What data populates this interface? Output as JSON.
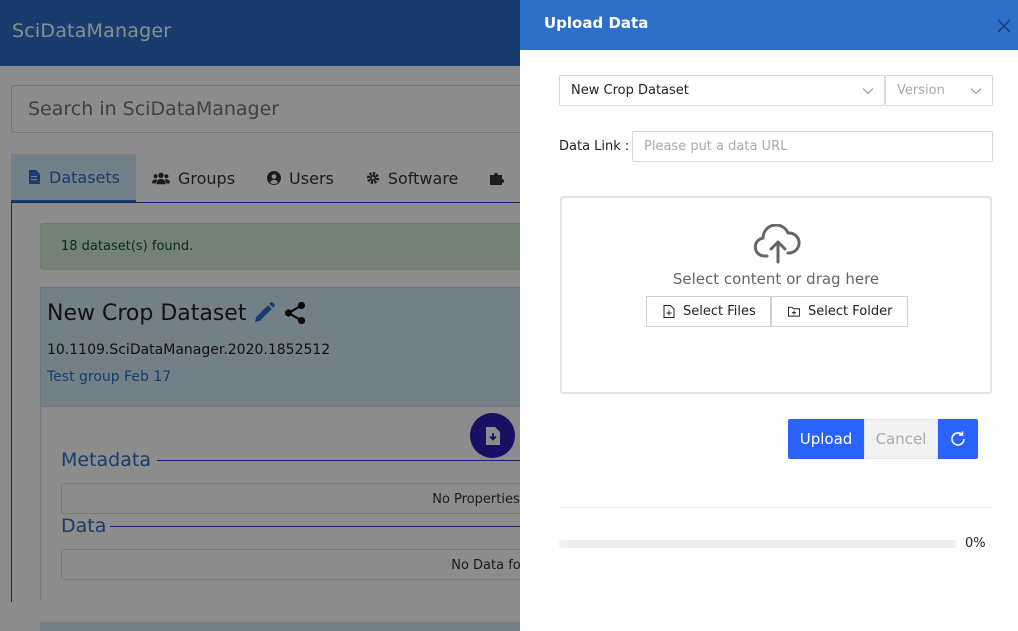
{
  "app": {
    "title": "SciDataManager",
    "search_placeholder": "Search in SciDataManager",
    "tabs": [
      {
        "label": "Datasets",
        "icon": "document-icon",
        "active": true
      },
      {
        "label": "Groups",
        "icon": "users-icon"
      },
      {
        "label": "Users",
        "icon": "user-circle-icon"
      },
      {
        "label": "Software",
        "icon": "gear-icon"
      }
    ],
    "alert_text": "18 dataset(s) found.",
    "dataset": {
      "title": "New Crop Dataset",
      "doi": "10.1109.SciDataManager.2020.1852512",
      "group": "Test group Feb 17",
      "metadata_heading": "Metadata",
      "metadata_empty": "No Properties",
      "data_heading": "Data",
      "data_empty": "No Data fo"
    }
  },
  "drawer": {
    "title": "Upload Data",
    "dataset_select": "New Crop Dataset",
    "version_placeholder": "Version",
    "data_link_label": "Data Link :",
    "data_link_placeholder": "Please put a data URL",
    "dropzone_text": "Select content or drag here",
    "select_files_label": "Select Files",
    "select_folder_label": "Select Folder",
    "upload_label": "Upload",
    "cancel_label": "Cancel",
    "progress_percent": 0,
    "progress_text": "0%"
  },
  "colors": {
    "header_blue": "#2d6ec9",
    "primary_button": "#2962ff",
    "download_circle": "#2d1fb5"
  }
}
